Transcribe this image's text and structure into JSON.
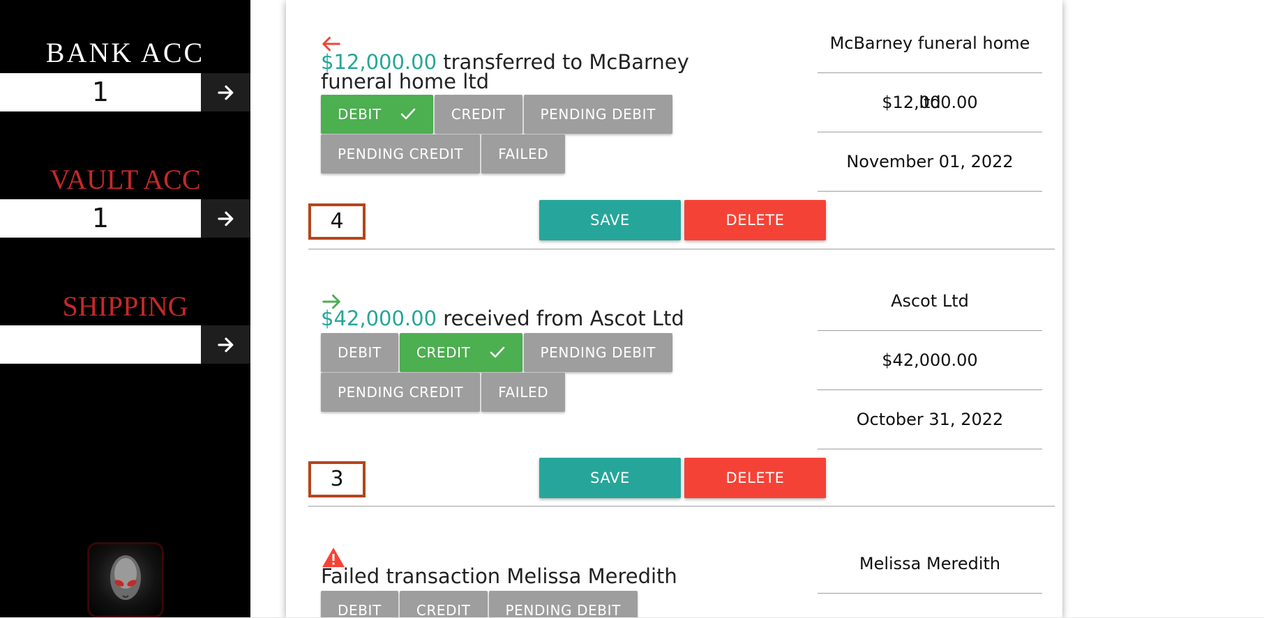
{
  "sidebar": {
    "bank_acc": {
      "title": "BANK ACC",
      "value": "1",
      "title_color": "#ffffff"
    },
    "vault_acc": {
      "title": "VAULT ACC",
      "value": "1",
      "title_color": "#c62828"
    },
    "shipping": {
      "title": "SHIPPING",
      "value": "",
      "title_color": "#c62828"
    },
    "go_icon": "arrow-right-icon",
    "logo_icon": "alien-head-logo"
  },
  "transactions": [
    {
      "direction_icon": "arrow-left-icon",
      "direction_color": "#f44336",
      "amount": "$12,000.00",
      "description": " transferred to McBarney funeral home ltd",
      "chips": [
        {
          "label": "DEBIT",
          "active": true
        },
        {
          "label": "CREDIT",
          "active": false
        },
        {
          "label": "PENDING DEBIT",
          "active": false
        },
        {
          "label": "PENDING CREDIT",
          "active": false
        },
        {
          "label": "FAILED",
          "active": false
        }
      ],
      "number": "4",
      "save_label": "SAVE",
      "delete_label": "DELETE",
      "party": "McBarney funeral home ltd",
      "amount_detail": "$12,000.00",
      "date": "November 01, 2022"
    },
    {
      "direction_icon": "arrow-right-icon",
      "direction_color": "#4caf50",
      "amount": "$42,000.00",
      "description": " received from Ascot Ltd",
      "chips": [
        {
          "label": "DEBIT",
          "active": false
        },
        {
          "label": "CREDIT",
          "active": true
        },
        {
          "label": "PENDING DEBIT",
          "active": false
        },
        {
          "label": "PENDING CREDIT",
          "active": false
        },
        {
          "label": "FAILED",
          "active": false
        }
      ],
      "number": "3",
      "save_label": "SAVE",
      "delete_label": "DELETE",
      "party": "Ascot Ltd",
      "amount_detail": "$42,000.00",
      "date": "October 31, 2022"
    },
    {
      "direction_icon": "warning-icon",
      "direction_color": "#f44336",
      "description": "Failed transaction Melissa Meredith",
      "chips": [
        {
          "label": "DEBIT",
          "active": false
        },
        {
          "label": "CREDIT",
          "active": false
        },
        {
          "label": "PENDING DEBIT",
          "active": false
        }
      ],
      "party": "Melissa Meredith"
    }
  ]
}
